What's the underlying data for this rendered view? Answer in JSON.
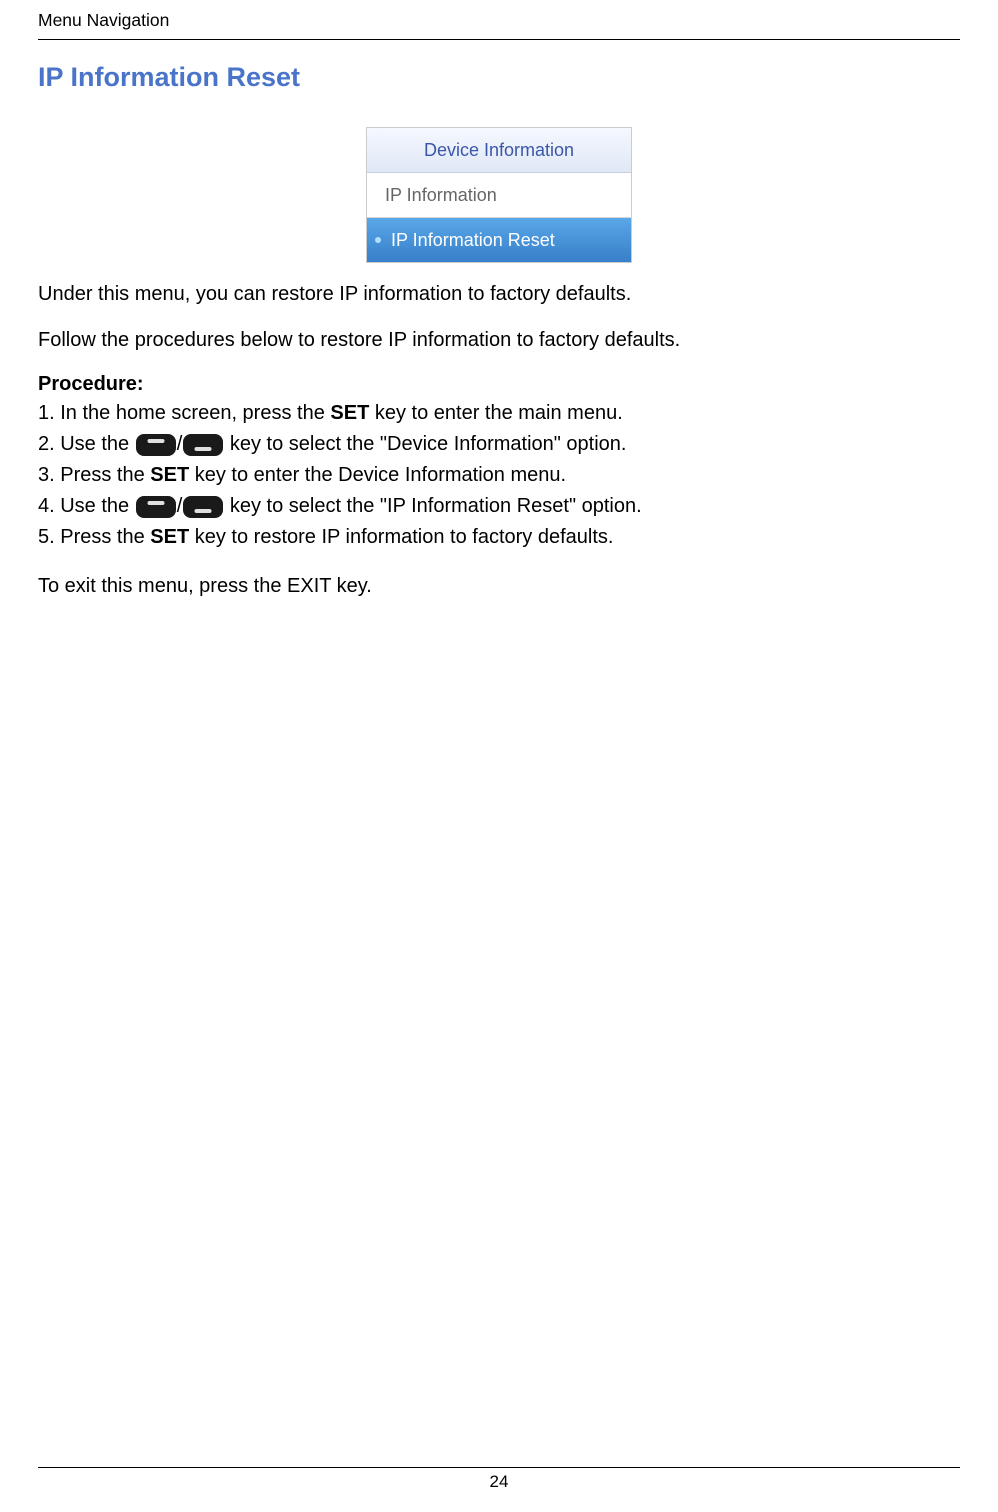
{
  "header": {
    "breadcrumb": "Menu Navigation"
  },
  "title": "IP Information Reset",
  "menu": {
    "header": "Device Information",
    "row1": "IP Information",
    "row2": "IP Information Reset"
  },
  "intro": "Under this menu, you can restore IP information to factory defaults.",
  "follow": "Follow the procedures below to restore IP information to factory defaults.",
  "procedure_label": "Procedure:",
  "steps": {
    "s1a": "1. In the home screen, press the ",
    "s1b": "SET",
    "s1c": " key to enter the main menu.",
    "s2a": "2. Use the ",
    "s2b": "/",
    "s2c": " key to select the \"Device Information\" option.",
    "s3a": "3. Press the ",
    "s3b": "SET",
    "s3c": " key to enter the Device Information menu.",
    "s4a": "4. Use the ",
    "s4b": "/",
    "s4c": " key to select the \"IP Information Reset\" option.",
    "s5a": "5. Press the ",
    "s5b": "SET",
    "s5c": " key to restore IP information to factory defaults."
  },
  "exit_a": "To exit this menu, press the ",
  "exit_b": "EXIT",
  "exit_c": " key.",
  "page_number": "24"
}
